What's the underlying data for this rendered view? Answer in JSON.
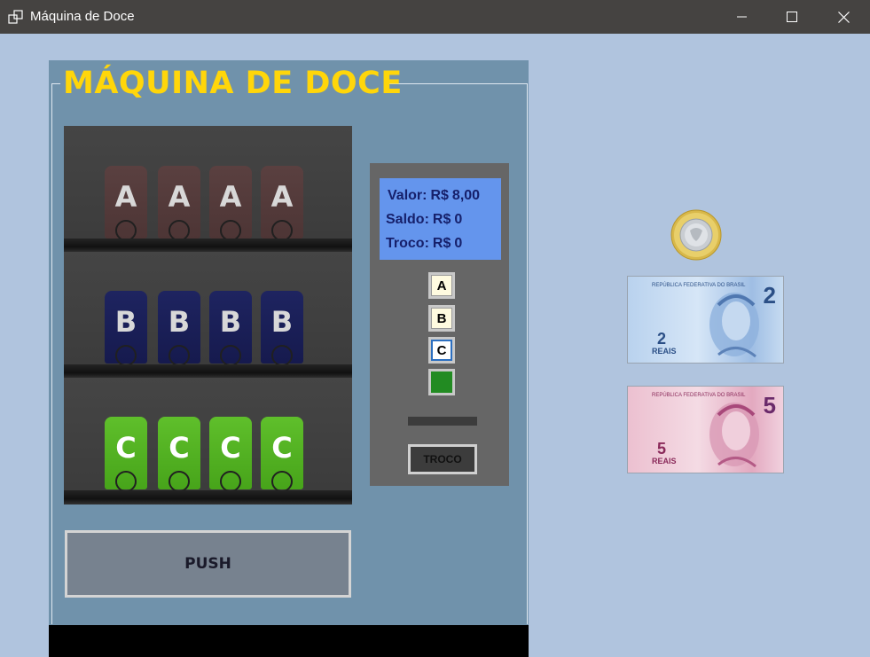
{
  "window": {
    "title": "Máquina de Doce",
    "minimize_icon": "minimize-icon",
    "maximize_icon": "maximize-icon",
    "close_icon": "close-icon"
  },
  "machine": {
    "title": "MÁQUINA DE DOCE",
    "rows": [
      {
        "label": "A",
        "items": [
          "A",
          "A",
          "A",
          "A"
        ],
        "color": "#4d3535"
      },
      {
        "label": "B",
        "items": [
          "B",
          "B",
          "B",
          "B"
        ],
        "color": "#161a4e"
      },
      {
        "label": "C",
        "items": [
          "C",
          "C",
          "C",
          "C"
        ],
        "color": "#47a41a"
      }
    ],
    "push_label": "PUSH"
  },
  "panel": {
    "display": {
      "valor_label": "Valor:",
      "valor_currency": "R$",
      "valor_value": "8,00",
      "saldo_label": "Saldo:",
      "saldo_currency": "R$",
      "saldo_value": "0",
      "troco_label": "Troco:",
      "troco_currency": "R$",
      "troco_value": "0"
    },
    "buttons": [
      "A",
      "B",
      "C"
    ],
    "confirm_color": "#228b22",
    "troco_button": "TROCO"
  },
  "money": {
    "coin": "1-real-coin",
    "bill2": {
      "header": "REPÚBLICA FEDERATIVA DO BRASIL",
      "value": "2",
      "unit": "REAIS"
    },
    "bill5": {
      "header": "REPÚBLICA FEDERATIVA DO BRASIL",
      "value": "5",
      "unit": "REAIS"
    }
  },
  "colors": {
    "titlebar": "#454341",
    "background": "#b0c4de",
    "machine": "#7092ab",
    "title_yellow": "#ffd60a",
    "display_bg": "#6495ed"
  }
}
